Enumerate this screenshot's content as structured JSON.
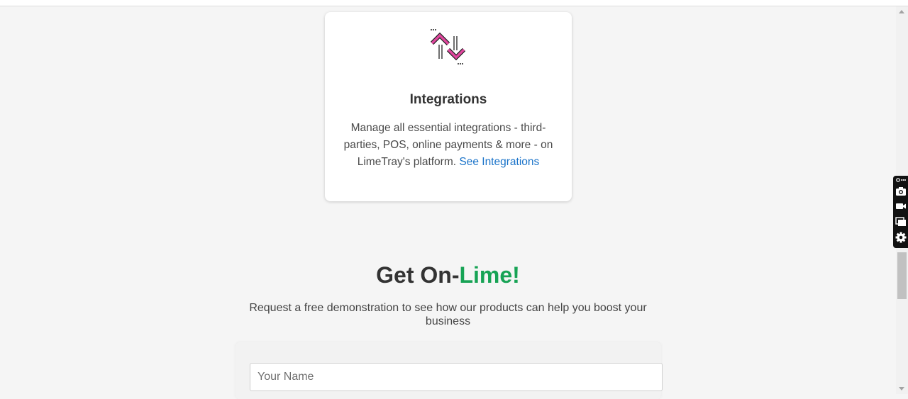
{
  "card": {
    "icon": "integrations-arrows-icon",
    "title": "Integrations",
    "description": "Manage all essential integrations - third-parties, POS, online payments & more - on LimeTray's platform.",
    "link_label": "See Integrations"
  },
  "cta": {
    "title_main": "Get On-",
    "title_accent": "Lime!",
    "subtitle": "Request a free demonstration to see how our products can help you boost your business"
  },
  "form": {
    "name_placeholder": "Your Name",
    "name_value": ""
  },
  "toolbar": {
    "icons": [
      "more-icon",
      "camera-icon",
      "video-icon",
      "screens-icon",
      "gear-icon"
    ]
  },
  "colors": {
    "accent_green": "#17a355",
    "link_blue": "#1a73c9",
    "icon_pink": "#e0479e"
  }
}
